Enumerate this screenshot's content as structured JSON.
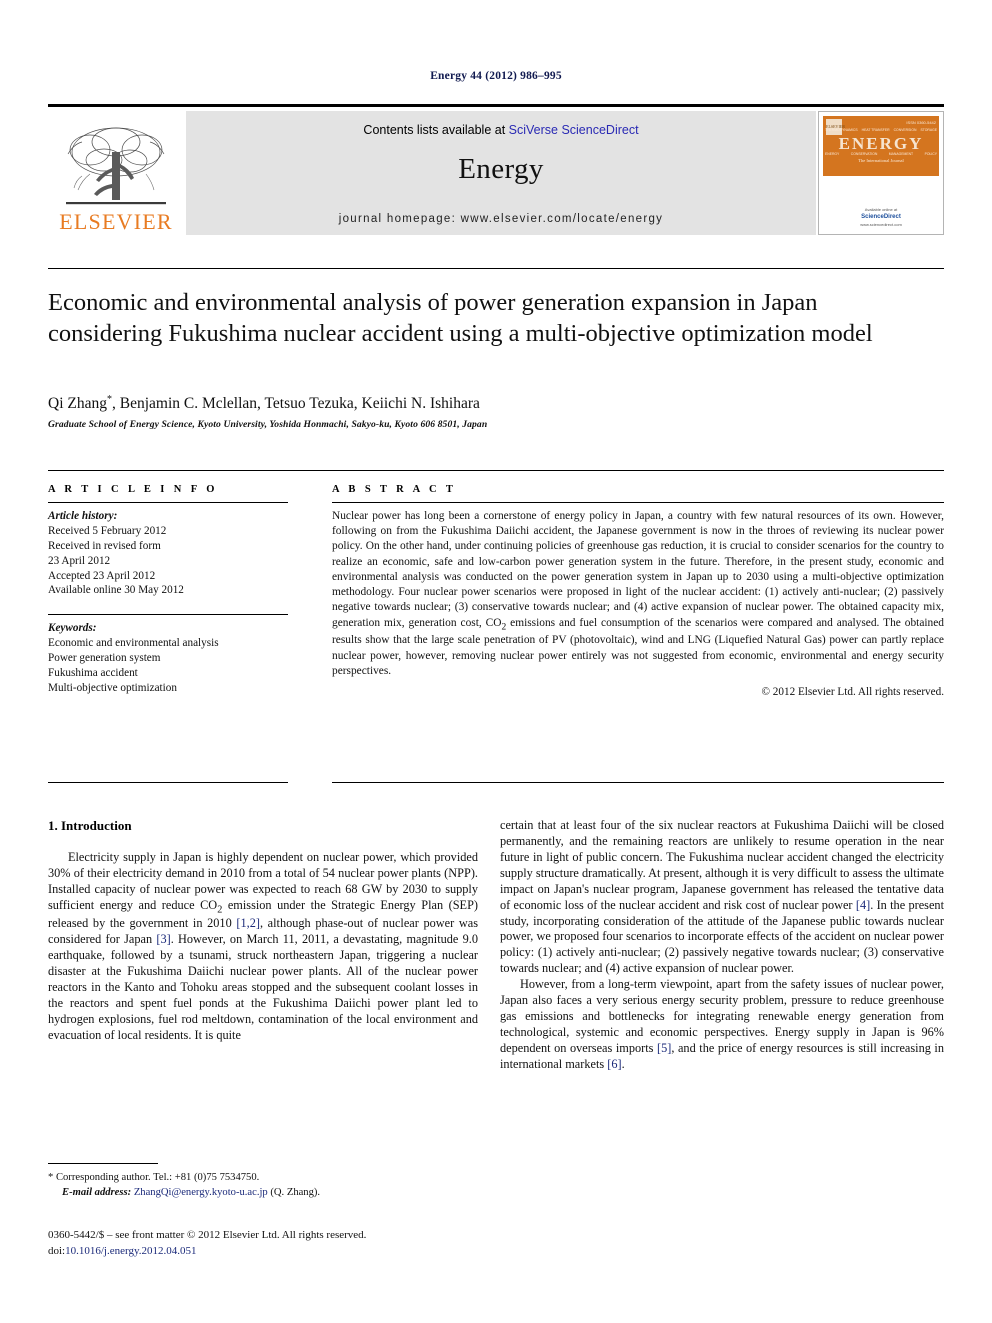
{
  "running_head": "Energy 44 (2012) 986–995",
  "masthead": {
    "publisher_name": "ELSEVIER",
    "contents_prefix": "Contents lists available at ",
    "contents_link": "SciVerse ScienceDirect",
    "journal_name": "Energy",
    "homepage": "journal homepage: www.elsevier.com/locate/energy",
    "cover": {
      "title": "ENERGY",
      "subtitle": "The International Journal",
      "issue_label": "ISSN 0360-5442",
      "publisher_mark": "ELSEVIER",
      "tags_top": [
        "THERMODYNAMICS",
        "HEAT TRANSFER",
        "CONVERSION",
        "STORAGE"
      ],
      "tags_bottom": [
        "ENERGY",
        "CONSERVATION",
        "MANAGEMENT",
        "POLICY"
      ],
      "bottom_line1": "Available online at",
      "bottom_line2": "ScienceDirect",
      "bottom_line3": "www.sciencedirect.com"
    }
  },
  "article": {
    "title": "Economic and environmental analysis of power generation expansion in Japan considering Fukushima nuclear accident using a multi-objective optimization model",
    "authors": "Qi Zhang, Benjamin C. Mclellan, Tetsuo Tezuka, Keiichi N. Ishihara",
    "author_marker": "*",
    "affiliation": "Graduate School of Energy Science, Kyoto University, Yoshida Honmachi, Sakyo-ku, Kyoto 606 8501, Japan"
  },
  "article_info": {
    "heading": "A R T I C L E  I N F O",
    "history_label": "Article history:",
    "history": [
      "Received 5 February 2012",
      "Received in revised form",
      "23 April 2012",
      "Accepted 23 April 2012",
      "Available online 30 May 2012"
    ],
    "keywords_label": "Keywords:",
    "keywords": [
      "Economic and environmental analysis",
      "Power generation system",
      "Fukushima accident",
      "Multi-objective optimization"
    ]
  },
  "abstract": {
    "heading": "A B S T R A C T",
    "text": "Nuclear power has long been a cornerstone of energy policy in Japan, a country with few natural resources of its own. However, following on from the Fukushima Daiichi accident, the Japanese government is now in the throes of reviewing its nuclear power policy. On the other hand, under continuing policies of greenhouse gas reduction, it is crucial to consider scenarios for the country to realize an economic, safe and low-carbon power generation system in the future. Therefore, in the present study, economic and environmental analysis was conducted on the power generation system in Japan up to 2030 using a multi-objective optimization methodology. Four nuclear power scenarios were proposed in light of the nuclear accident: (1) actively anti-nuclear; (2) passively negative towards nuclear; (3) conservative towards nuclear; and (4) active expansion of nuclear power. The obtained capacity mix, generation mix, generation cost, CO2 emissions and fuel consumption of the scenarios were compared and analysed. The obtained results show that the large scale penetration of PV (photovoltaic), wind and LNG (Liquefied Natural Gas) power can partly replace nuclear power, however, removing nuclear power entirely was not suggested from economic, environmental and energy security perspectives.",
    "copyright": "© 2012 Elsevier Ltd. All rights reserved."
  },
  "body": {
    "section_number_title": "1.  Introduction",
    "left_paragraphs": [
      "Electricity supply in Japan is highly dependent on nuclear power, which provided 30% of their electricity demand in 2010 from a total of 54 nuclear power plants (NPP). Installed capacity of nuclear power was expected to reach 68 GW by 2030 to supply sufficient energy and reduce CO2 emission under the Strategic Energy Plan (SEP) released by the government in 2010 [1,2], although phase-out of nuclear power was considered for Japan [3]. However, on March 11, 2011, a devastating, magnitude 9.0 earthquake, followed by a tsunami, struck northeastern Japan, triggering a nuclear disaster at the Fukushima Daiichi nuclear power plants. All of the nuclear power reactors in the Kanto and Tohoku areas stopped and the subsequent coolant losses in the reactors and spent fuel ponds at the Fukushima Daiichi power plant led to hydrogen explosions, fuel rod meltdown, contamination of the local environment and evacuation of local residents. It is quite"
    ],
    "right_paragraphs": [
      "certain that at least four of the six nuclear reactors at Fukushima Daiichi will be closed permanently, and the remaining reactors are unlikely to resume operation in the near future in light of public concern. The Fukushima nuclear accident changed the electricity supply structure dramatically. At present, although it is very difficult to assess the ultimate impact on Japan's nuclear program, Japanese government has released the tentative data of economic loss of the nuclear accident and risk cost of nuclear power [4]. In the present study, incorporating consideration of the attitude of the Japanese public towards nuclear power, we proposed four scenarios to incorporate effects of the accident on nuclear power policy: (1) actively anti-nuclear; (2) passively negative towards nuclear; (3) conservative towards nuclear; and (4) active expansion of nuclear power.",
      "However, from a long-term viewpoint, apart from the safety issues of nuclear power, Japan also faces a very serious energy security problem, pressure to reduce greenhouse gas emissions and bottlenecks for integrating renewable energy generation from technological, systemic and economic perspectives. Energy supply in Japan is 96% dependent on overseas imports [5], and the price of energy resources is still increasing in international markets [6]."
    ]
  },
  "footnotes": {
    "corresponding": "* Corresponding author. Tel.: +81 (0)75 7534750.",
    "email_label": "E-mail address:",
    "email": "ZhangQi@energy.kyoto-u.ac.jp",
    "email_suffix": " (Q. Zhang).",
    "imprint_line1": "0360-5442/$ – see front matter © 2012 Elsevier Ltd. All rights reserved.",
    "doi_label": "doi:",
    "doi": "10.1016/j.energy.2012.04.051"
  }
}
